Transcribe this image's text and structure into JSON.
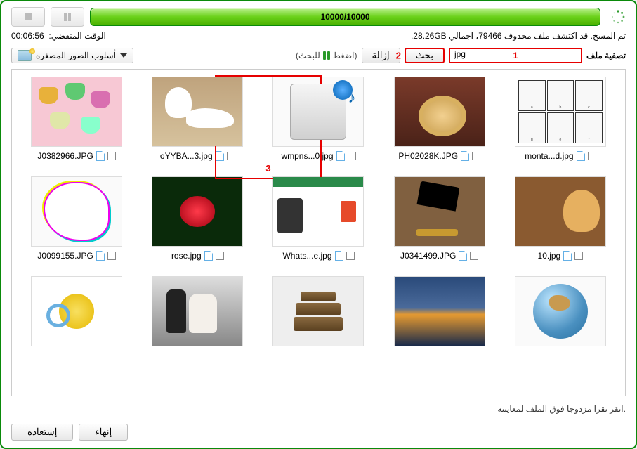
{
  "progress": {
    "label": "10000/10000"
  },
  "elapsed": {
    "label": "الوقت المنقضي:",
    "value": "00:06:56"
  },
  "scan_summary": "تم المسح. قد اكتشف ملف محذوف 79466، اجمالي 28.26GB.",
  "filter": {
    "label": "تصفية ملف",
    "value": "jpg",
    "search": "بحث",
    "remove": "إزالة",
    "hint_prefix": "(اضغط",
    "hint_suffix": "للبحث)",
    "viewmode": "أسلوب الصور المصغره"
  },
  "annotations": {
    "input": "1",
    "search": "2",
    "item": "3"
  },
  "items": [
    {
      "name": "J0382966.JPG"
    },
    {
      "name": "oYYBA...3.jpg"
    },
    {
      "name": "wmpns...0.jpg"
    },
    {
      "name": "PH02028K.JPG"
    },
    {
      "name": "monta...d.jpg"
    },
    {
      "name": "J0099155.JPG"
    },
    {
      "name": "rose.jpg"
    },
    {
      "name": "Whats...e.jpg"
    },
    {
      "name": "J0341499.JPG"
    },
    {
      "name": "10.jpg"
    },
    {
      "name": ""
    },
    {
      "name": ""
    },
    {
      "name": ""
    },
    {
      "name": ""
    },
    {
      "name": ""
    }
  ],
  "footer_hint": "انقر نقرا مزدوجا فوق الملف لمعاينته.",
  "buttons": {
    "recover": "إستعاده",
    "finish": "إنهاء"
  }
}
